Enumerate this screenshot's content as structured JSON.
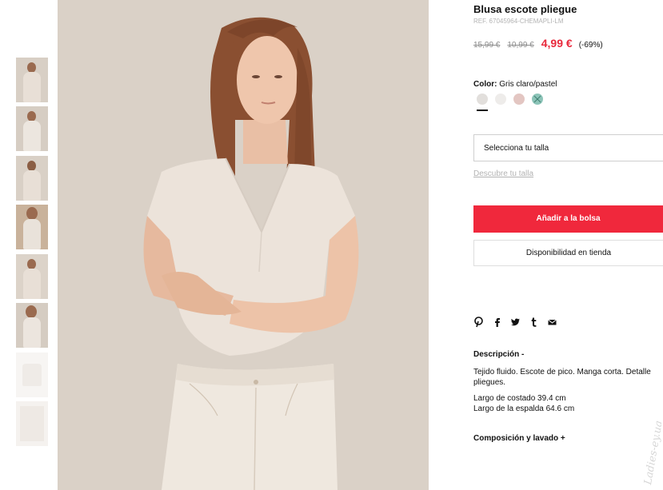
{
  "product": {
    "title": "Blusa escote pliegue",
    "ref": "REF. 67045964-CHEMAPLI-LM",
    "old_price_1": "15,99 €",
    "old_price_2": "10,99 €",
    "sale_price": "4,99 €",
    "discount": "(-69%)",
    "sale_color": "#f0283c"
  },
  "color": {
    "label": "Color:",
    "value": "Gris claro/pastel",
    "swatches": [
      {
        "name": "gris claro",
        "hex": "#e2dfdc",
        "selected": true
      },
      {
        "name": "blanco",
        "hex": "#eeecea",
        "selected": false
      },
      {
        "name": "rosa",
        "hex": "#e3c6c2",
        "selected": false
      },
      {
        "name": "verde agua",
        "hex": "#8cc4b8",
        "selected": false,
        "unavailable": true
      }
    ]
  },
  "size": {
    "placeholder": "Selecciona tu talla",
    "guide_link": "Descubre tu talla"
  },
  "actions": {
    "add_to_bag": "Añadir a la bolsa",
    "store_availability": "Disponibilidad en tienda"
  },
  "social": {
    "icons": [
      "pinterest-icon",
      "facebook-icon",
      "twitter-icon",
      "tumblr-icon",
      "email-icon"
    ]
  },
  "description": {
    "title": "Descripción  -",
    "text": "Tejido fluido. Escote de pico. Manga corta. Detalle pliegues.",
    "measure_1": "Largo de costado 39.4 cm",
    "measure_2": "Largo de la espalda 64.6 cm"
  },
  "composition": {
    "title": "Composición y lavado  +"
  },
  "gallery": {
    "thumbnail_count": 8
  },
  "watermark": {
    "text": "Ladies-ey.ua"
  }
}
